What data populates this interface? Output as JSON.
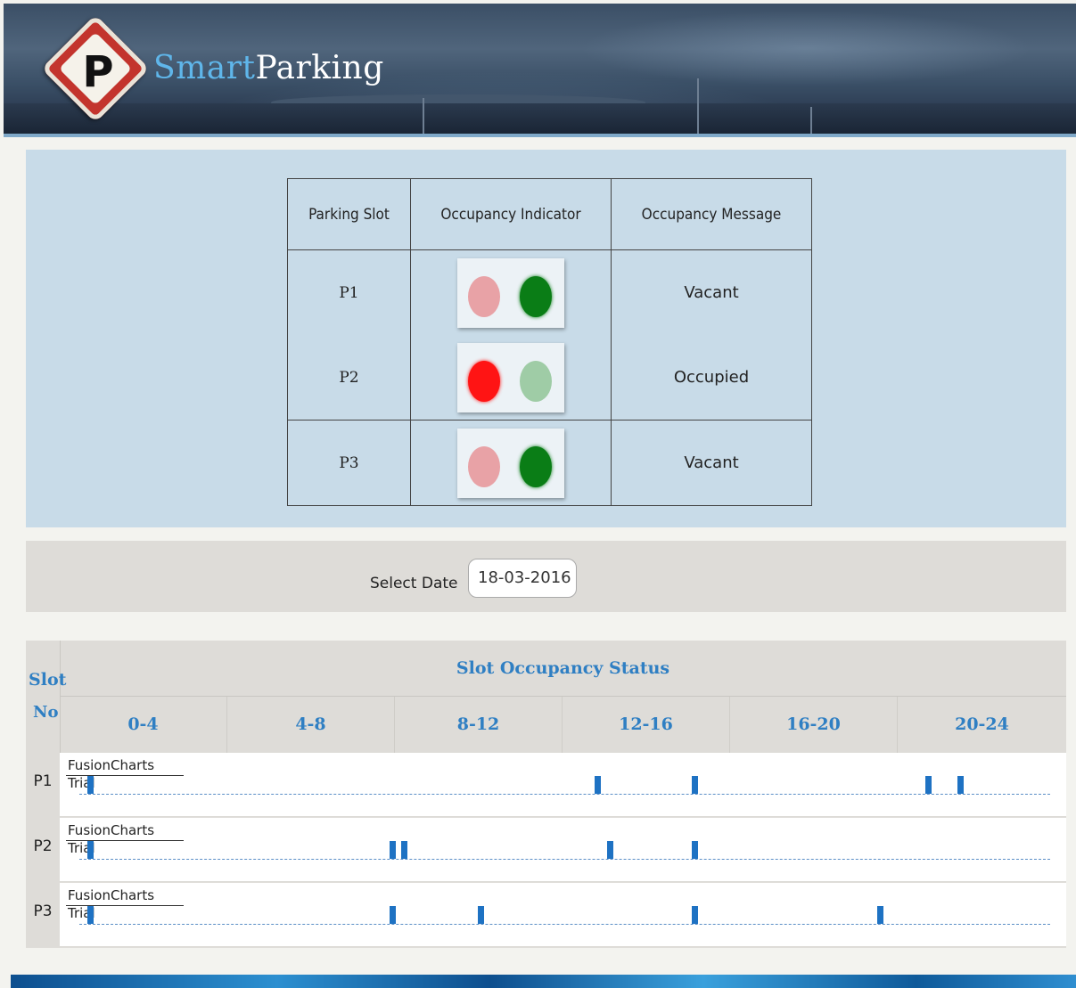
{
  "header": {
    "logo_letter": "P",
    "brand_part1": "Smart",
    "brand_part2": "Parking",
    "icon": "parking-sign-icon"
  },
  "status_table": {
    "columns": [
      "Parking Slot",
      "Occupancy Indicator",
      "Occupancy Message"
    ],
    "rows": [
      {
        "slot": "P1",
        "red_on": false,
        "green_on": true,
        "message": "Vacant"
      },
      {
        "slot": "P2",
        "red_on": true,
        "green_on": false,
        "message": "Occupied"
      },
      {
        "slot": "P3",
        "red_on": false,
        "green_on": true,
        "message": "Vacant"
      }
    ],
    "colors": {
      "red_on": "#ff1414",
      "red_off": "#e8a2a6",
      "green_on": "#0a7d16",
      "green_off": "#9fcca6"
    }
  },
  "date_select": {
    "label": "Select Date",
    "value": "18-03-2016"
  },
  "occupancy_grid": {
    "slot_header_line1": "Slot",
    "slot_header_line2": "No",
    "title": "Slot Occupancy Status",
    "time_ranges": [
      "0-4",
      "4-8",
      "8-12",
      "12-16",
      "16-20",
      "20-24"
    ],
    "watermark": "FusionCharts Trial",
    "accent_color": "#2f7fc3",
    "mark_color": "#1e72c3"
  },
  "chart_data": {
    "type": "scatter",
    "title": "Slot Occupancy Status",
    "xlabel": "",
    "ylabel": "Slot No",
    "x_unit": "hour",
    "xlim": [
      0,
      24
    ],
    "categories": [
      "0-4",
      "4-8",
      "8-12",
      "12-16",
      "16-20",
      "20-24"
    ],
    "series": [
      {
        "name": "P1",
        "hours": [
          0.1,
          12.7,
          15.1,
          20.9,
          21.7
        ]
      },
      {
        "name": "P2",
        "hours": [
          0.1,
          7.6,
          7.9,
          13.0,
          15.1
        ]
      },
      {
        "name": "P3",
        "hours": [
          0.1,
          7.6,
          9.8,
          15.1,
          19.7
        ]
      }
    ]
  }
}
